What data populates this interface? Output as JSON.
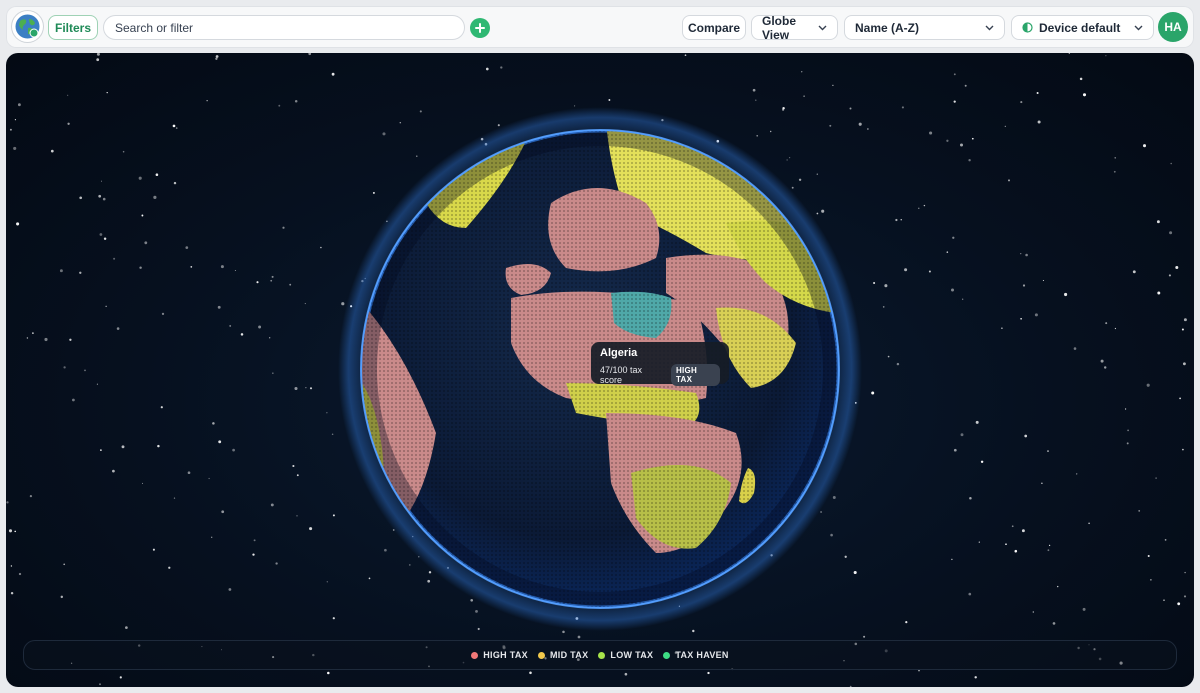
{
  "toolbar": {
    "filters_label": "Filters",
    "search_placeholder": "Search or filter",
    "compare_label": "Compare",
    "view_select": "Globe View",
    "sort_select": "Name (A-Z)",
    "theme_select": "Device default",
    "avatar_initials": "HA"
  },
  "tooltip": {
    "country": "Algeria",
    "score": "47/100 tax score",
    "badge": "HIGH TAX"
  },
  "legend": [
    {
      "label": "HIGH TAX",
      "color": "#f07878"
    },
    {
      "label": "MID TAX",
      "color": "#f2c94c"
    },
    {
      "label": "LOW TAX",
      "color": "#a7e34a"
    },
    {
      "label": "TAX HAVEN",
      "color": "#3ddc84"
    }
  ],
  "colors": {
    "accent": "#2fb873",
    "high_tax": "#f07878",
    "mid_tax": "#e9e35a",
    "low_tax": "#a7d94a",
    "tax_haven": "#4fb6b0",
    "globe_glow": "#3a8cff"
  },
  "icons": {
    "logo": "globe-logo-icon",
    "add": "plus-icon",
    "chevron": "chevron-down-icon",
    "theme": "half-circle-icon"
  }
}
